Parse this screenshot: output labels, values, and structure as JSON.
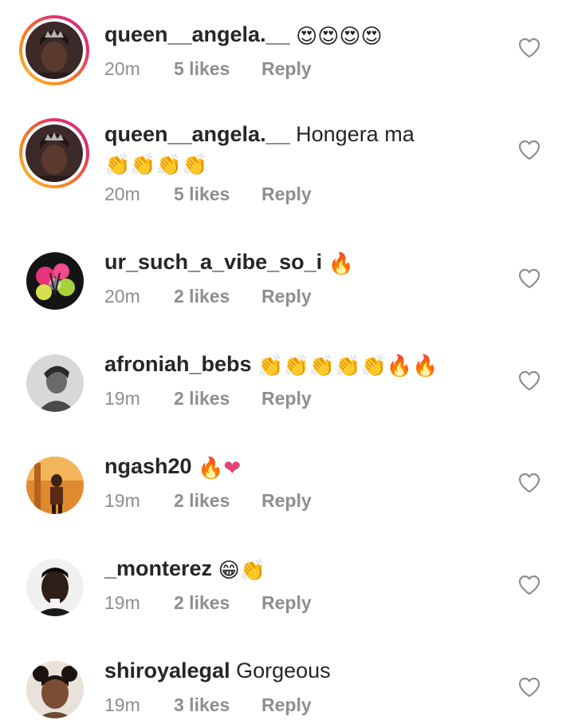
{
  "comments": [
    {
      "username": "queen__angela.__",
      "text": "",
      "emojis": "😍😍😍😍",
      "time": "20m",
      "likes": "5 likes",
      "reply": "Reply",
      "has_story": true,
      "avatar_color": "#5a4038"
    },
    {
      "username": "queen__angela.__",
      "text": " Hongera ma",
      "emojis": "👏👏👏👏",
      "time": "20m",
      "likes": "5 likes",
      "reply": "Reply",
      "has_story": true,
      "avatar_color": "#5a4038"
    },
    {
      "username": "ur_such_a_vibe_so_i",
      "text": "",
      "emojis": "🔥",
      "time": "20m",
      "likes": "2 likes",
      "reply": "Reply",
      "has_story": false,
      "avatar_color": "#1a1a1a"
    },
    {
      "username": "afroniah_bebs",
      "text": "",
      "emojis": "👏👏👏👏👏🔥🔥",
      "time": "19m",
      "likes": "2 likes",
      "reply": "Reply",
      "has_story": false,
      "avatar_color": "#bdbdbd"
    },
    {
      "username": "ngash20",
      "text": "",
      "emojis": "🔥❤",
      "time": "19m",
      "likes": "2 likes",
      "reply": "Reply",
      "has_story": false,
      "avatar_color": "#d87c2a"
    },
    {
      "username": "_monterez",
      "text": "",
      "emojis": "😁👏",
      "time": "19m",
      "likes": "2 likes",
      "reply": "Reply",
      "has_story": false,
      "avatar_color": "#3b2a22"
    },
    {
      "username": "shiroyalegal",
      "text": " Gorgeous",
      "emojis": "",
      "time": "19m",
      "likes": "3 likes",
      "reply": "Reply",
      "has_story": false,
      "avatar_color": "#a07a60"
    }
  ],
  "colors": {
    "text": "#262626",
    "meta": "#8e8e8e",
    "heart_outline": "#8e8e8e"
  }
}
